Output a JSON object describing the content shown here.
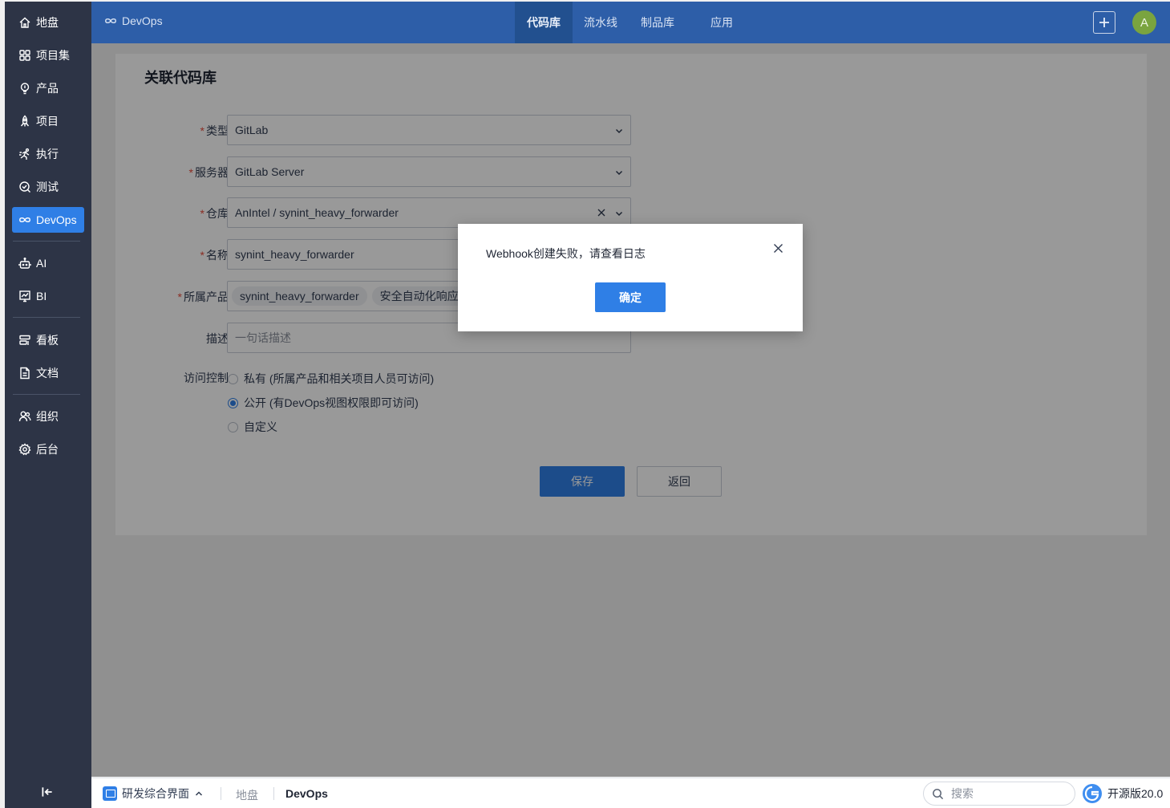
{
  "sidebar": {
    "items": [
      {
        "label": "地盘",
        "icon": "home-icon"
      },
      {
        "label": "项目集",
        "icon": "grid-icon"
      },
      {
        "label": "产品",
        "icon": "bulb-icon"
      },
      {
        "label": "项目",
        "icon": "rocket-icon"
      },
      {
        "label": "执行",
        "icon": "run-icon"
      },
      {
        "label": "测试",
        "icon": "test-icon"
      },
      {
        "label": "DevOps",
        "icon": "infinity-icon"
      },
      {
        "label": "AI",
        "icon": "robot-icon"
      },
      {
        "label": "BI",
        "icon": "chart-icon"
      },
      {
        "label": "看板",
        "icon": "kanban-icon"
      },
      {
        "label": "文档",
        "icon": "document-icon"
      },
      {
        "label": "组织",
        "icon": "people-icon"
      },
      {
        "label": "后台",
        "icon": "gear-icon"
      }
    ],
    "active": "DevOps"
  },
  "header": {
    "app_name": "DevOps",
    "tabs": [
      "代码库",
      "流水线",
      "制品库",
      "应用"
    ],
    "active_tab": "代码库",
    "avatar_letter": "A"
  },
  "form": {
    "title": "关联代码库",
    "type": {
      "label": "类型",
      "value": "GitLab"
    },
    "server": {
      "label": "服务器",
      "value": "GitLab Server"
    },
    "repo": {
      "label": "仓库",
      "value": "AnIntel / synint_heavy_forwarder"
    },
    "name": {
      "label": "名称",
      "value": "synint_heavy_forwarder"
    },
    "product": {
      "label": "所属产品",
      "tags": [
        "synint_heavy_forwarder",
        "安全自动化响应平"
      ]
    },
    "desc": {
      "label": "描述",
      "placeholder": "一句话描述"
    },
    "access": {
      "label": "访问控制",
      "options": [
        "私有 (所属产品和相关项目人员可访问)",
        "公开 (有DevOps视图权限即可访问)",
        "自定义"
      ],
      "selected_index": 1
    },
    "save_label": "保存",
    "back_label": "返回"
  },
  "modal": {
    "message": "Webhook创建失败，请查看日志",
    "ok_label": "确定"
  },
  "taskbar": {
    "app_label": "研发综合界面",
    "link": "地盘",
    "current": "DevOps",
    "search_placeholder": "搜索",
    "version": "开源版20.0"
  },
  "colors": {
    "accent": "#2f7fe6",
    "header": "#2d5ea8",
    "sidebar": "#2d3446",
    "required": "#e74c3c"
  }
}
